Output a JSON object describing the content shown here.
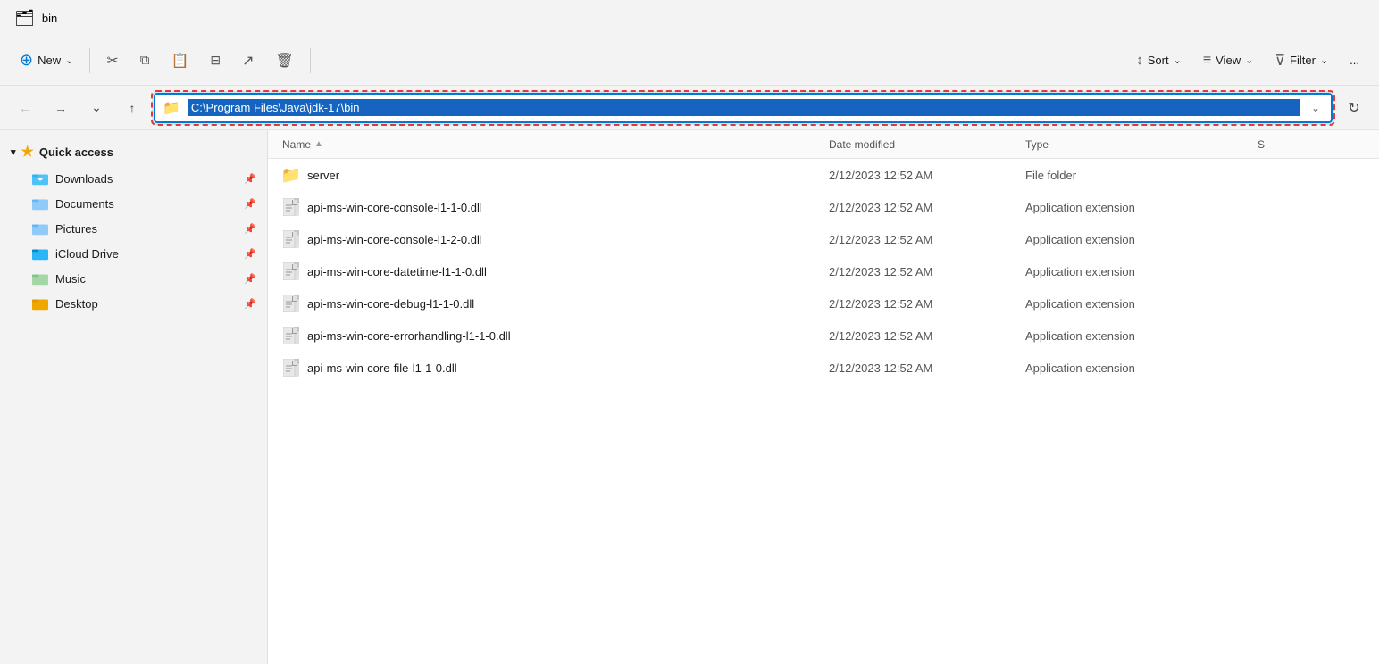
{
  "titleBar": {
    "icon": "📁",
    "title": "bin"
  },
  "toolbar": {
    "newLabel": "New",
    "newChevron": "⌄",
    "buttons": [
      {
        "id": "cut",
        "icon": "✂",
        "label": ""
      },
      {
        "id": "copy",
        "icon": "⬜",
        "label": ""
      },
      {
        "id": "paste",
        "icon": "📋",
        "label": ""
      },
      {
        "id": "rename",
        "icon": "✏",
        "label": ""
      },
      {
        "id": "share",
        "icon": "↗",
        "label": ""
      },
      {
        "id": "delete",
        "icon": "🗑",
        "label": ""
      }
    ],
    "sortLabel": "Sort",
    "viewLabel": "View",
    "filterLabel": "Filter",
    "moreLabel": "..."
  },
  "addressBar": {
    "path": "C:\\Program Files\\Java\\jdk-17\\bin",
    "folderIcon": "📁"
  },
  "sidebar": {
    "quickAccessLabel": "Quick access",
    "items": [
      {
        "id": "downloads",
        "label": "Downloads",
        "icon": "downloads",
        "pinned": true
      },
      {
        "id": "documents",
        "label": "Documents",
        "icon": "documents",
        "pinned": true
      },
      {
        "id": "pictures",
        "label": "Pictures",
        "icon": "pictures",
        "pinned": true
      },
      {
        "id": "icloud",
        "label": "iCloud Drive",
        "icon": "icloud",
        "pinned": true
      },
      {
        "id": "music",
        "label": "Music",
        "icon": "music",
        "pinned": true
      },
      {
        "id": "desktop",
        "label": "Desktop",
        "icon": "desktop",
        "pinned": true
      }
    ]
  },
  "columns": {
    "name": "Name",
    "dateModified": "Date modified",
    "type": "Type",
    "size": "S"
  },
  "files": [
    {
      "name": "server",
      "type": "folder",
      "dateModified": "2/12/2023 12:52 AM",
      "fileType": "File folder",
      "size": ""
    },
    {
      "name": "api-ms-win-core-console-l1-1-0.dll",
      "type": "dll",
      "dateModified": "2/12/2023 12:52 AM",
      "fileType": "Application extension",
      "size": ""
    },
    {
      "name": "api-ms-win-core-console-l1-2-0.dll",
      "type": "dll",
      "dateModified": "2/12/2023 12:52 AM",
      "fileType": "Application extension",
      "size": ""
    },
    {
      "name": "api-ms-win-core-datetime-l1-1-0.dll",
      "type": "dll",
      "dateModified": "2/12/2023 12:52 AM",
      "fileType": "Application extension",
      "size": ""
    },
    {
      "name": "api-ms-win-core-debug-l1-1-0.dll",
      "type": "dll",
      "dateModified": "2/12/2023 12:52 AM",
      "fileType": "Application extension",
      "size": ""
    },
    {
      "name": "api-ms-win-core-errorhandling-l1-1-0.dll",
      "type": "dll",
      "dateModified": "2/12/2023 12:52 AM",
      "fileType": "Application extension",
      "size": ""
    },
    {
      "name": "api-ms-win-core-file-l1-1-0.dll",
      "type": "dll",
      "dateModified": "2/12/2023 12:52 AM",
      "fileType": "Application extension",
      "size": ""
    }
  ]
}
